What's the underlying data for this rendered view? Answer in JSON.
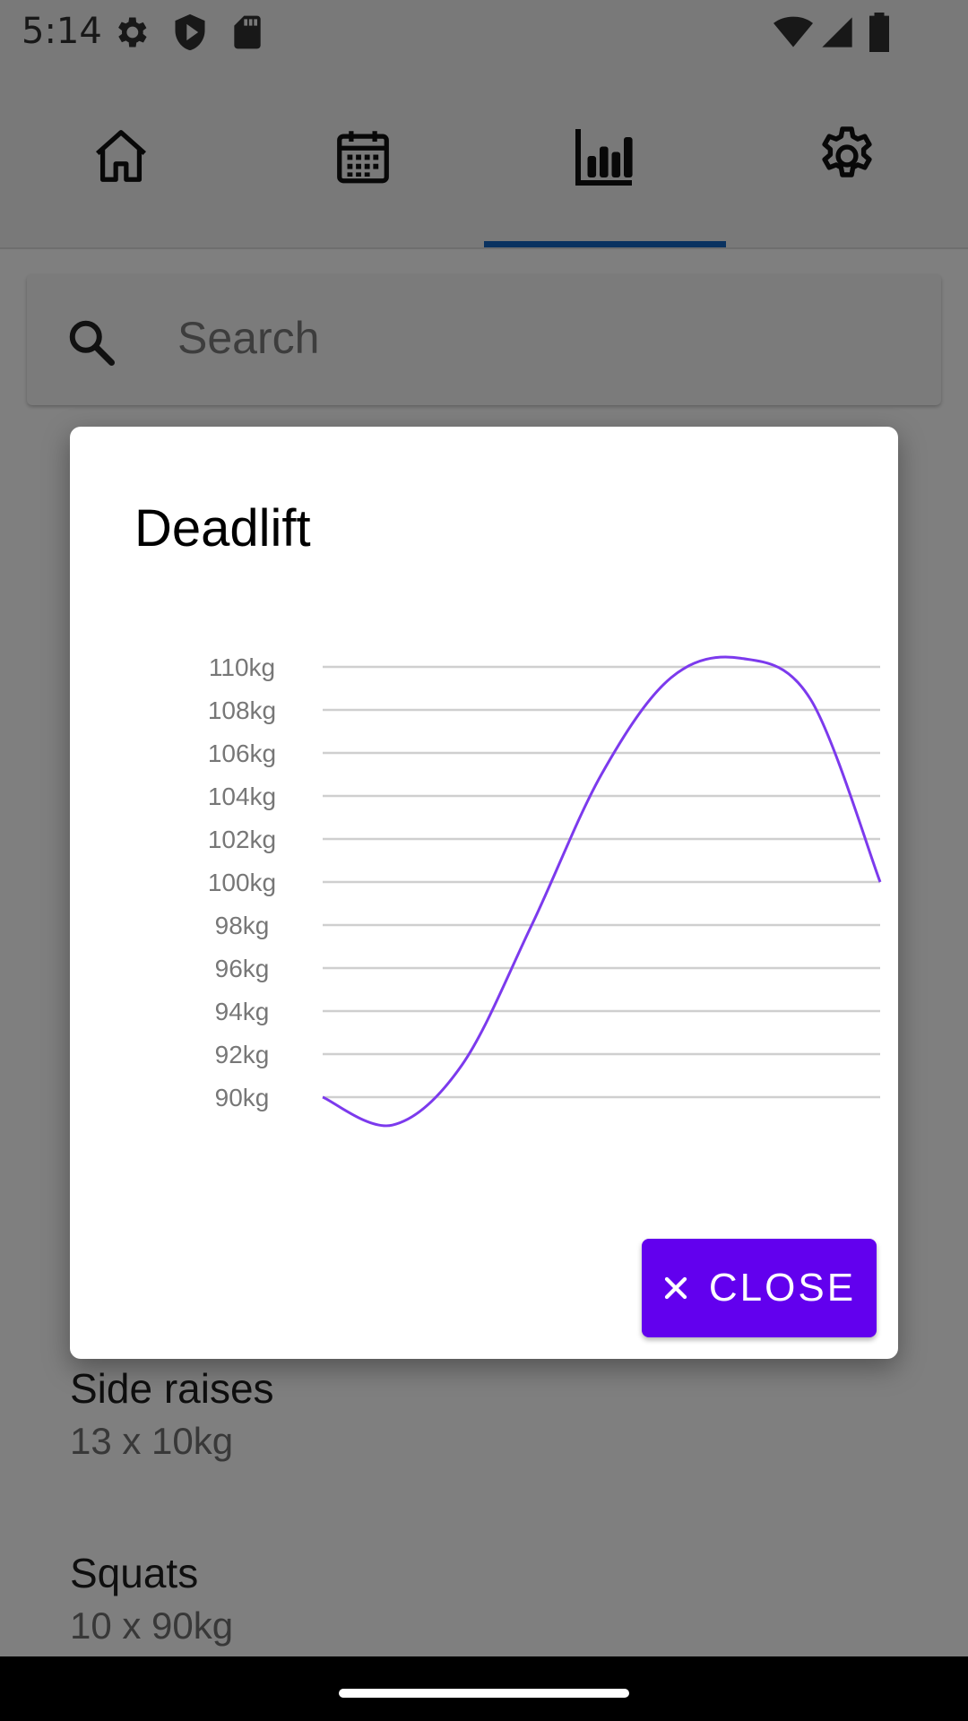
{
  "status_bar": {
    "time": "5:14",
    "left_icons": [
      "settings-icon",
      "shield-icon",
      "sd-card-icon"
    ],
    "right_icons": [
      "wifi-icon",
      "signal-icon",
      "battery-icon"
    ]
  },
  "tabs": [
    {
      "icon": "home-icon",
      "selected": false
    },
    {
      "icon": "calendar-icon",
      "selected": false
    },
    {
      "icon": "bar-chart-icon",
      "selected": true
    },
    {
      "icon": "gear-icon",
      "selected": false
    }
  ],
  "search": {
    "placeholder": "Search"
  },
  "exercises": [
    {
      "name": "Side raises",
      "detail": "13 x 10kg"
    },
    {
      "name": "Squats",
      "detail": "10 x 90kg"
    }
  ],
  "dialog": {
    "title": "Deadlift",
    "close_label": "CLOSE"
  },
  "chart_data": {
    "type": "line",
    "title": "Deadlift",
    "y_tick_labels": [
      "110kg",
      "108kg",
      "106kg",
      "104kg",
      "102kg",
      "100kg",
      "98kg",
      "96kg",
      "94kg",
      "92kg",
      "90kg"
    ],
    "ylim": [
      90,
      110
    ],
    "series": [
      {
        "values": [
          90,
          88.7,
          91.5,
          98,
          105,
          109.5,
          110.4,
          108.5,
          100
        ]
      }
    ],
    "grid": true,
    "line_color": "#7c3aed"
  },
  "colors": {
    "accent": "#6200ee",
    "tab_indicator": "#1565c0"
  }
}
